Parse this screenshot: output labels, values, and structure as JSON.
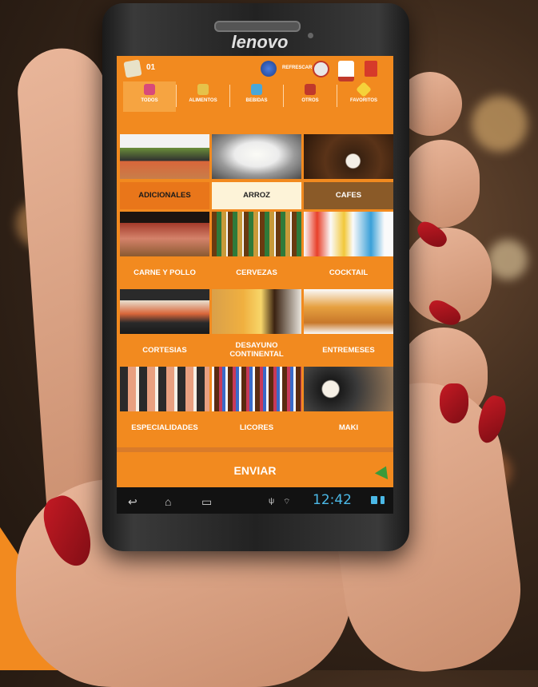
{
  "device": {
    "brand": "lenovo"
  },
  "app": {
    "order_number": "01",
    "top_action_label": "REFRESCAR",
    "tabs": [
      {
        "label": "TODOS",
        "active": true
      },
      {
        "label": "ALIMENTOS",
        "active": false
      },
      {
        "label": "BEBIDAS",
        "active": false
      },
      {
        "label": "OTROS",
        "active": false
      },
      {
        "label": "FAVORITOS",
        "active": false
      }
    ],
    "categories": [
      {
        "label": "ADICIONALES",
        "image": "sushi-platter"
      },
      {
        "label": "ARROZ",
        "image": "rice-bowl"
      },
      {
        "label": "CAFES",
        "image": "coffee-cup"
      },
      {
        "label": "CARNE Y POLLO",
        "image": "meat-board"
      },
      {
        "label": "CERVEZAS",
        "image": "beer-bottles"
      },
      {
        "label": "COCKTAIL",
        "image": "cocktail-glasses"
      },
      {
        "label": "CORTESIAS",
        "image": "sushi-rolls"
      },
      {
        "label": "DESAYUNO CONTINENTAL",
        "image": "breakfast"
      },
      {
        "label": "ENTREMESES",
        "image": "fried-snacks"
      },
      {
        "label": "ESPECIALIDADES",
        "image": "sushi-specials"
      },
      {
        "label": "LICORES",
        "image": "liquor-bottles"
      },
      {
        "label": "MAKI",
        "image": "maki-rolls"
      }
    ],
    "send_label": "ENVIAR",
    "status_time": "12:42",
    "accent_color": "#f28a1f"
  }
}
